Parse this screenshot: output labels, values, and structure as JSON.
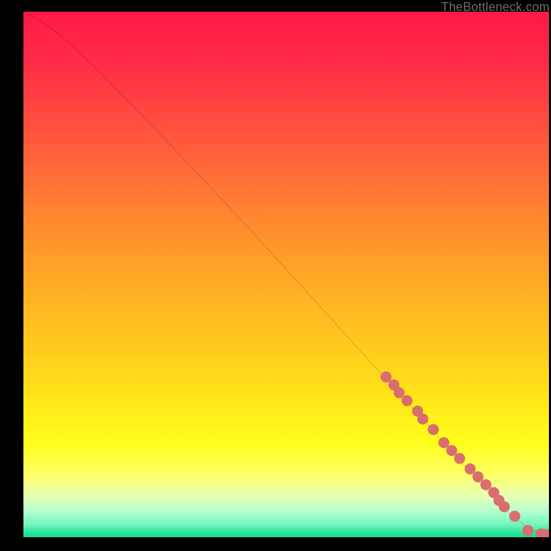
{
  "watermark": "TheBottleneck.com",
  "chart_data": {
    "type": "line",
    "title": "",
    "xlabel": "",
    "ylabel": "",
    "xlim": [
      0,
      100
    ],
    "ylim": [
      0,
      100
    ],
    "grid": false,
    "legend": false,
    "colors": {
      "curve": "#000000",
      "marker_fill": "#d86e6e",
      "marker_stroke": "#d86e6e"
    },
    "series": [
      {
        "name": "bottleneck-curve",
        "type": "line",
        "x": [
          0,
          4,
          10,
          20,
          30,
          40,
          50,
          60,
          70,
          80,
          88,
          92,
          95,
          97,
          99,
          100
        ],
        "y": [
          100,
          98,
          93,
          83,
          72.5,
          62,
          51,
          40,
          29,
          18,
          9,
          5,
          2.5,
          1.2,
          0.5,
          0.4
        ]
      },
      {
        "name": "sample-points",
        "type": "scatter",
        "x": [
          69.0,
          70.5,
          71.5,
          73.0,
          75.0,
          76.0,
          78.0,
          80.0,
          81.5,
          83.0,
          85.0,
          86.5,
          88.0,
          89.5,
          90.5,
          91.5,
          93.5,
          96.0,
          98.5,
          99.5
        ],
        "y": [
          30.5,
          29.0,
          27.5,
          26.0,
          24.0,
          22.5,
          20.5,
          18.0,
          16.5,
          15.0,
          13.0,
          11.5,
          10.0,
          8.5,
          7.0,
          5.8,
          4.0,
          1.3,
          0.6,
          0.5
        ]
      }
    ]
  }
}
